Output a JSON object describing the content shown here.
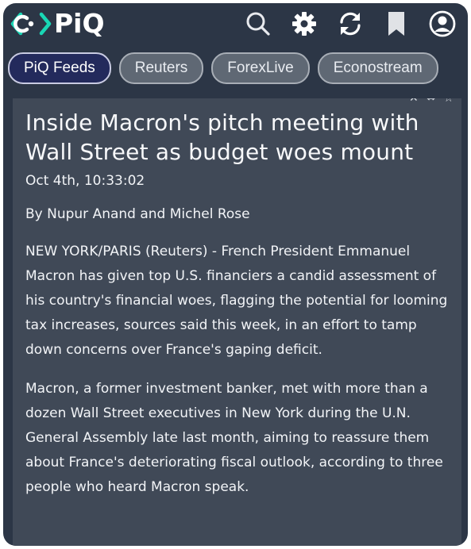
{
  "app": {
    "logo_text": "PiQ"
  },
  "header": {
    "icons": [
      "search-icon",
      "settings-icon",
      "refresh-icon",
      "bookmark-icon",
      "account-icon"
    ]
  },
  "tabs": [
    {
      "label": "PiQ Feeds",
      "active": true
    },
    {
      "label": "Reuters",
      "active": false
    },
    {
      "label": "ForexLive",
      "active": false
    },
    {
      "label": "Econostream",
      "active": false
    }
  ],
  "article": {
    "headline": "Inside Macron's pitch meeting with Wall Street as budget woes mount",
    "timestamp": "Oct 4th, 10:33:02",
    "byline": "By Nupur Anand and Michel Rose",
    "paragraphs": [
      "NEW YORK/PARIS (Reuters) - French President Emmanuel Macron has given top U.S. financiers a candid assessment of his country's financial woes, flagging the potential for looming tax increases, sources said this week, in an effort to tamp down concerns over France's gaping deficit.",
      "Macron, a former investment banker, met with more than a dozen Wall Street executives in New York during the U.N. General Assembly late last month, aiming to reassure them about France's deteriorating fiscal outlook, according to three people who heard Macron speak."
    ]
  },
  "colors": {
    "frame_bg": "#2c3646",
    "article_bg": "#404957",
    "logo_accent": "#19d6b5",
    "active_tab_bg": "#232a5c"
  }
}
